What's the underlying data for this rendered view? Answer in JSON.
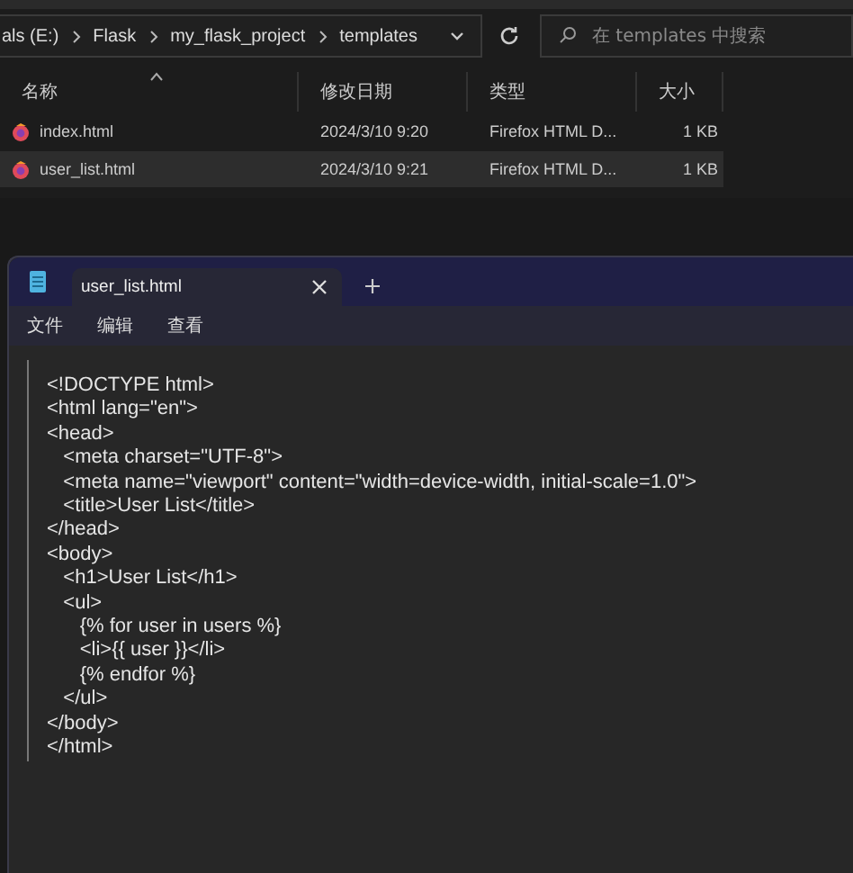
{
  "explorer": {
    "breadcrumb": [
      "als (E:)",
      "Flask",
      "my_flask_project",
      "templates"
    ],
    "search": {
      "placeholder": "在 templates 中搜索"
    },
    "columns": [
      {
        "label": "名称",
        "sorted": true
      },
      {
        "label": "修改日期",
        "sorted": false
      },
      {
        "label": "类型",
        "sorted": false
      },
      {
        "label": "大小",
        "sorted": false
      }
    ],
    "files": [
      {
        "name": "index.html",
        "modified": "2024/3/10 9:20",
        "type": "Firefox HTML D...",
        "size": "1 KB",
        "selected": false
      },
      {
        "name": "user_list.html",
        "modified": "2024/3/10 9:21",
        "type": "Firefox HTML D...",
        "size": "1 KB",
        "selected": true
      }
    ]
  },
  "notepad": {
    "tabs": [
      {
        "label": "user_list.html",
        "selected": true
      }
    ],
    "menu": [
      "文件",
      "编辑",
      "查看"
    ],
    "lines": [
      "<!DOCTYPE html>",
      "<html lang=\"en\">",
      "<head>",
      "   <meta charset=\"UTF-8\">",
      "   <meta name=\"viewport\" content=\"width=device-width, initial-scale=1.0\">",
      "   <title>User List</title>",
      "</head>",
      "<body>",
      "   <h1>User List</h1>",
      "   <ul>",
      "      {% for user in users %}",
      "      <li>{{ user }}</li>",
      "      {% endfor %}",
      "   </ul>",
      "</body>",
      "</html>"
    ]
  }
}
